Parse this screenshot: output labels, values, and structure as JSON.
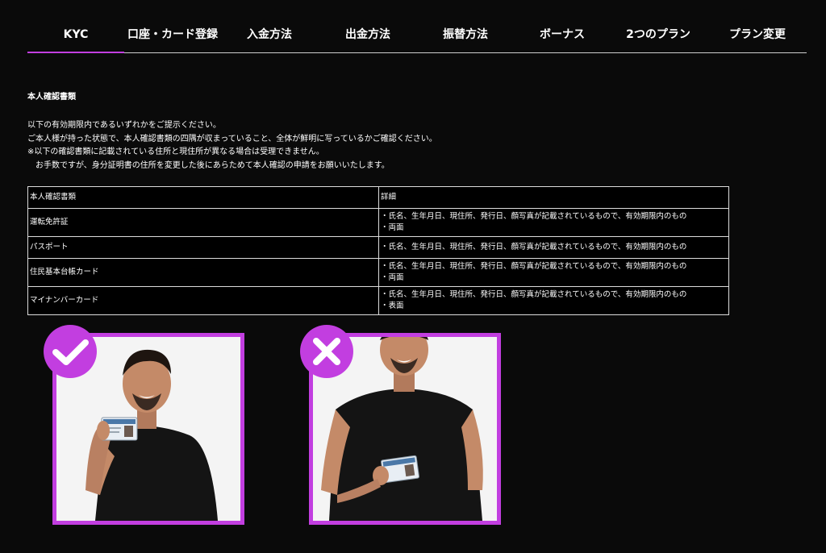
{
  "tabs": [
    {
      "label": "KYC",
      "active": true
    },
    {
      "label": "口座・カード登録",
      "active": false
    },
    {
      "label": "入金方法",
      "active": false
    },
    {
      "label": "出金方法",
      "active": false
    },
    {
      "label": "振替方法",
      "active": false
    },
    {
      "label": "ボーナス",
      "active": false
    },
    {
      "label": "2つのプラン",
      "active": false
    },
    {
      "label": "プラン変更",
      "active": false
    }
  ],
  "section_title": "本人確認書類",
  "intro": [
    "以下の有効期限内であるいずれかをご提示ください。",
    "ご本人様が持った状態で、本人確認書類の四隅が収まっていること、全体が鮮明に写っているかご確認ください。",
    "※以下の確認書類に記載されている住所と現住所が異なる場合は受理できません。",
    "お手数ですが、身分証明書の住所を変更した後にあらためて本人確認の申請をお願いいたします。"
  ],
  "table": {
    "headers": [
      "本人確認書類",
      "詳細"
    ],
    "rows": [
      {
        "doc": "運転免許証",
        "details": [
          "・氏名、生年月日、現住所、発行日、顔写真が記載されているもので、有効期限内のもの",
          "・両面"
        ]
      },
      {
        "doc": "パスポート",
        "details": [
          "・氏名、生年月日、現住所、発行日、顔写真が記載されているもので、有効期限内のもの"
        ]
      },
      {
        "doc": "住民基本台帳カード",
        "details": [
          "・氏名、生年月日、現住所、発行日、顔写真が記載されているもので、有効期限内のもの",
          "・両面"
        ]
      },
      {
        "doc": "マイナンバーカード",
        "details": [
          "・氏名、生年月日、現住所、発行日、顔写真が記載されているもので、有効期限内のもの",
          "・表面"
        ]
      }
    ]
  },
  "examples": [
    {
      "status": "correct",
      "icon": "check-icon"
    },
    {
      "status": "incorrect",
      "icon": "cross-icon"
    }
  ],
  "colors": {
    "accent": "#c23ee0",
    "background": "#0a0a0a",
    "text": "#ffffff",
    "border": "#dcdcdc"
  }
}
